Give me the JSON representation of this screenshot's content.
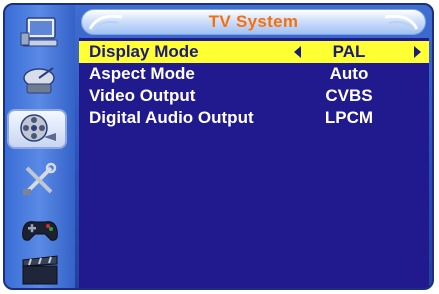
{
  "title": "TV System",
  "sidebar": {
    "items": [
      {
        "icon": "monitor-icon"
      },
      {
        "icon": "satellite-dish-icon"
      },
      {
        "icon": "film-reel-icon",
        "active": true
      },
      {
        "icon": "tools-icon"
      },
      {
        "icon": "gamepad-icon"
      },
      {
        "icon": "clapperboard-icon"
      }
    ]
  },
  "menu": {
    "rows": [
      {
        "label": "Display Mode",
        "value": "PAL",
        "selected": true
      },
      {
        "label": "Aspect Mode",
        "value": "Auto"
      },
      {
        "label": "Video Output",
        "value": "CVBS"
      },
      {
        "label": "Digital Audio Output",
        "value": "LPCM"
      }
    ]
  },
  "colors": {
    "panel": "#211a8f",
    "highlight": "#ffff33",
    "title": "#f07018"
  }
}
